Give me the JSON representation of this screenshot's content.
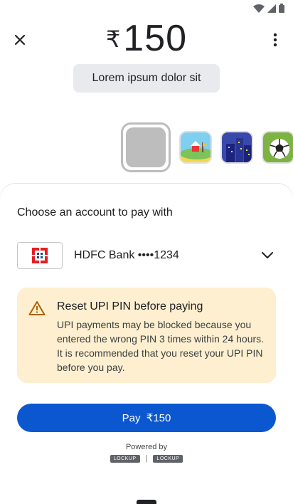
{
  "status": {
    "wifi_icon": "wifi-icon",
    "signal_icon": "signal-icon",
    "battery_icon": "battery-icon"
  },
  "header": {
    "currency": "₹",
    "amount": "150",
    "note": "Lorem ipsum dolor sit",
    "close_icon": "close-icon",
    "more_icon": "more-vert-icon"
  },
  "stickers": [
    "blank-sticker",
    "beach-house-sticker",
    "city-night-sticker",
    "soccer-ball-sticker"
  ],
  "sheet": {
    "title": "Choose an account to pay with",
    "account": {
      "bank_name": "HDFC Bank ••••1234",
      "logo": "hdfc-logo"
    },
    "warning": {
      "title": "Reset UPI PIN before paying",
      "body": "UPI payments may be blocked because you entered the wrong PIN 3 times within 24 hours.  It is recommended that you reset your UPI PIN before you pay."
    },
    "pay_button": "Pay  ₹150",
    "powered_by": "Powered by",
    "lockups": [
      "LOCKUP",
      "LOCKUP"
    ],
    "separator": "|"
  },
  "colors": {
    "primary": "#0b57d0",
    "warning_bg": "#fdefcf",
    "warning_icon": "#b06000",
    "bank_red": "#e31e24"
  }
}
